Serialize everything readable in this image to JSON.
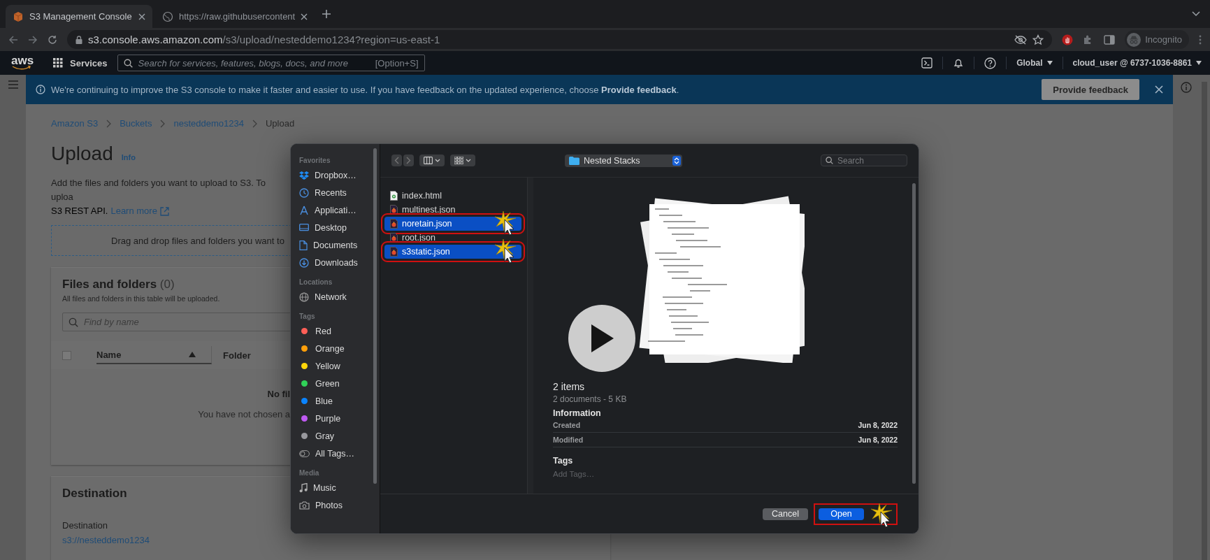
{
  "browser": {
    "tabs": [
      {
        "title": "S3 Management Console",
        "selected": true
      },
      {
        "title": "https://raw.githubusercontent",
        "selected": false
      }
    ],
    "url_host": "s3.console.aws.amazon.com",
    "url_path": "/s3/upload/nesteddemo1234?region=us-east-1",
    "profile": "Incognito"
  },
  "aws_nav": {
    "logo": "aws",
    "services": "Services",
    "search_placeholder": "Search for services, features, blogs, docs, and more",
    "search_shortcut": "[Option+S]",
    "region": "Global",
    "account": "cloud_user @ 6737-1036-8861"
  },
  "banner": {
    "message": "We're continuing to improve the S3 console to make it faster and easier to use. If you have feedback on the updated experience, choose **Provide feedback**.",
    "button": "Provide feedback"
  },
  "breadcrumbs": [
    {
      "label": "Amazon S3",
      "current": false
    },
    {
      "label": "Buckets",
      "current": false
    },
    {
      "label": "nesteddemo1234",
      "current": false
    },
    {
      "label": "Upload",
      "current": true
    }
  ],
  "page": {
    "title": "Upload",
    "info": "Info",
    "description": "Add the files and folders you want to upload to S3. To uploa",
    "description_2": "S3 REST API.",
    "learn_more": "Learn more",
    "drop_zone": "Drag and drop files and folders you want to"
  },
  "files_table": {
    "title": "Files and folders",
    "count": "(0)",
    "select_all_checked": false,
    "subtitle": "All files and folders in this table will be uploaded.",
    "search_placeholder": "Find by name",
    "columns": [
      {
        "label": "Name",
        "sorted": true
      },
      {
        "label": "Folder",
        "sorted": false
      }
    ],
    "empty_title": "No fil",
    "empty_text": "You have not chosen a"
  },
  "destination": {
    "title": "Destination",
    "label": "Destination",
    "value": "s3://nesteddemo1234"
  },
  "dialog": {
    "sidebar": [
      {
        "heading": "Favorites",
        "items": [
          {
            "label": "Dropbox…",
            "kind": "dropbox"
          },
          {
            "label": "Recents",
            "kind": "recents"
          },
          {
            "label": "Applicati…",
            "kind": "apps"
          },
          {
            "label": "Desktop",
            "kind": "desktop"
          },
          {
            "label": "Documents",
            "kind": "documents"
          },
          {
            "label": "Downloads",
            "kind": "downloads"
          }
        ]
      },
      {
        "heading": "Locations",
        "items": [
          {
            "label": "Network",
            "kind": "network"
          }
        ]
      },
      {
        "heading": "Tags",
        "items": [
          {
            "label": "Red",
            "kind": "tag",
            "color": "#ff5f57"
          },
          {
            "label": "Orange",
            "kind": "tag",
            "color": "#ff9f0a"
          },
          {
            "label": "Yellow",
            "kind": "tag",
            "color": "#ffd60a"
          },
          {
            "label": "Green",
            "kind": "tag",
            "color": "#30d158"
          },
          {
            "label": "Blue",
            "kind": "tag",
            "color": "#0a84ff"
          },
          {
            "label": "Purple",
            "kind": "tag",
            "color": "#bf5af2"
          },
          {
            "label": "Gray",
            "kind": "tag",
            "color": "#98989d"
          },
          {
            "label": "All Tags…",
            "kind": "alltags"
          }
        ]
      },
      {
        "heading": "Media",
        "items": [
          {
            "label": "Music",
            "kind": "music"
          },
          {
            "label": "Photos",
            "kind": "photos"
          }
        ]
      }
    ],
    "location": "Nested Stacks",
    "search_placeholder": "Search",
    "files": [
      {
        "name": "index.html",
        "kind": "html",
        "selected": false,
        "highlighted": false
      },
      {
        "name": "multinest.json",
        "kind": "json",
        "selected": false,
        "highlighted": false
      },
      {
        "name": "noretain.json",
        "kind": "json",
        "selected": true,
        "highlighted": true
      },
      {
        "name": "root.json",
        "kind": "json",
        "selected": false,
        "highlighted": false
      },
      {
        "name": "s3static.json",
        "kind": "json",
        "selected": true,
        "highlighted": true
      }
    ],
    "preview": {
      "summary": "2 items",
      "detail": "2 documents - 5 KB",
      "info_heading": "Information",
      "info": [
        {
          "label": "Created",
          "value": "Jun 8, 2022"
        },
        {
          "label": "Modified",
          "value": "Jun 8, 2022"
        }
      ],
      "tags_heading": "Tags",
      "tags_placeholder": "Add Tags…"
    },
    "buttons": [
      {
        "label": "Cancel",
        "kind": "secondary"
      },
      {
        "label": "Open",
        "kind": "primary"
      }
    ],
    "open_button_annotated": true
  }
}
